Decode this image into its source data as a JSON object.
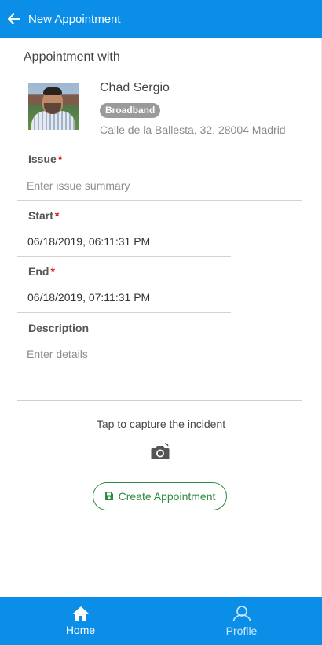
{
  "header": {
    "title": "New Appointment",
    "back_icon": "arrow-left-icon"
  },
  "appointment": {
    "section_title": "Appointment with",
    "contact": {
      "name": "Chad Sergio",
      "badge": "Broadband",
      "address": "Calle de la Ballesta, 32, 28004 Madrid"
    }
  },
  "form": {
    "issue": {
      "label": "Issue",
      "required_mark": "*",
      "placeholder": "Enter issue summary"
    },
    "start": {
      "label": "Start",
      "required_mark": "*",
      "value": "06/18/2019, 06:11:31 PM"
    },
    "end": {
      "label": "End",
      "required_mark": "*",
      "value": "06/18/2019, 07:11:31 PM"
    },
    "description": {
      "label": "Description",
      "placeholder": "Enter details"
    }
  },
  "capture": {
    "text": "Tap to capture the incident",
    "icon": "camera-icon"
  },
  "create_button": {
    "label": "Create Appointment",
    "icon": "save-icon"
  },
  "bottom_nav": {
    "items": [
      {
        "label": "Home",
        "icon": "home-icon",
        "active": true
      },
      {
        "label": "Profile",
        "icon": "profile-icon",
        "active": false
      }
    ]
  },
  "colors": {
    "primary": "#0b8ee8",
    "accent_green": "#2e8b3d",
    "required": "#e3120b",
    "badge": "#9a9a9a"
  }
}
